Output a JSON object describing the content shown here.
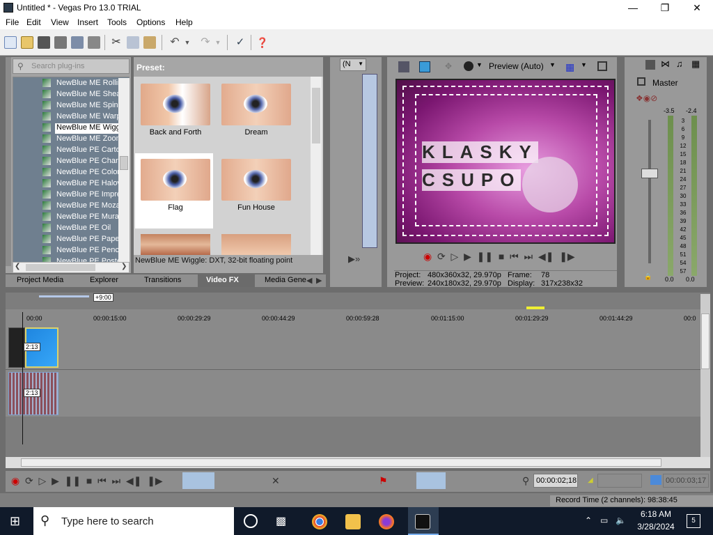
{
  "window": {
    "title": "Untitled * - Vegas Pro 13.0 TRIAL"
  },
  "menu": [
    "File",
    "Edit",
    "View",
    "Insert",
    "Tools",
    "Options",
    "Help"
  ],
  "plugins": {
    "search_placeholder": "Search plug-ins",
    "items": [
      "NewBlue ME Rollin",
      "NewBlue ME Shear",
      "NewBlue ME Spin E",
      "NewBlue ME Warp",
      "NewBlue ME Wiggl",
      "NewBlue ME Zoom",
      "NewBlue PE Carto",
      "NewBlue PE Charc",
      "NewBlue PE Colore",
      "NewBlue PE Halovi",
      "NewBlue PE Impre",
      "NewBlue PE Mozaic",
      "NewBlue PE Mural",
      "NewBlue PE Oil",
      "NewBlue PE Paper",
      "NewBlue PE Pencil",
      "NewBlue PE Poster"
    ],
    "selected": "NewBlue ME Wiggl"
  },
  "presets": {
    "heading": "Preset:",
    "items": [
      "Back and Forth",
      "Dream",
      "Flag",
      "Fun House"
    ],
    "selected": "Flag",
    "description": "NewBlue ME Wiggle: DXT, 32-bit floating point"
  },
  "tabs": [
    "Project Media",
    "Explorer",
    "Transitions",
    "Video FX",
    "Media Gene"
  ],
  "active_tab": "Video FX",
  "trimmer": {
    "dropdown": "(N"
  },
  "preview": {
    "mode": "Preview (Auto)",
    "project_label": "Project:",
    "project_value": "480x360x32, 29.970p",
    "preview_label": "Preview:",
    "preview_value": "240x180x32, 29.970p",
    "frame_label": "Frame:",
    "frame_value": "78",
    "display_label": "Display:",
    "display_value": "317x238x32",
    "screen_text_line1": "KLASKY",
    "screen_text_line2": "CSUPO"
  },
  "mixer": {
    "title": "Master",
    "peak_left": "-3.5",
    "peak_right": "-2.4",
    "scale": [
      "3",
      "6",
      "9",
      "12",
      "15",
      "18",
      "21",
      "24",
      "27",
      "30",
      "33",
      "36",
      "39",
      "42",
      "45",
      "48",
      "51",
      "54",
      "57"
    ],
    "level_left": "0.0",
    "level_right": "0.0"
  },
  "timeline": {
    "offset_badge": "+9:00",
    "ruler": [
      "00:00",
      "00:00:15:00",
      "00:00:29:29",
      "00:00:44:29",
      "00:00:59:28",
      "00:01:15:00",
      "00:01:29:29",
      "00:01:44:29",
      "00:0"
    ],
    "clip_label": "2:13",
    "timecode": "00:00:02;18",
    "timecode2": "00:00:03;17"
  },
  "status": {
    "record_time": "Record Time (2 channels): 98:38:45"
  },
  "taskbar": {
    "search_placeholder": "Type here to search",
    "time": "6:18 AM",
    "date": "3/28/2024",
    "notifications": "5"
  }
}
